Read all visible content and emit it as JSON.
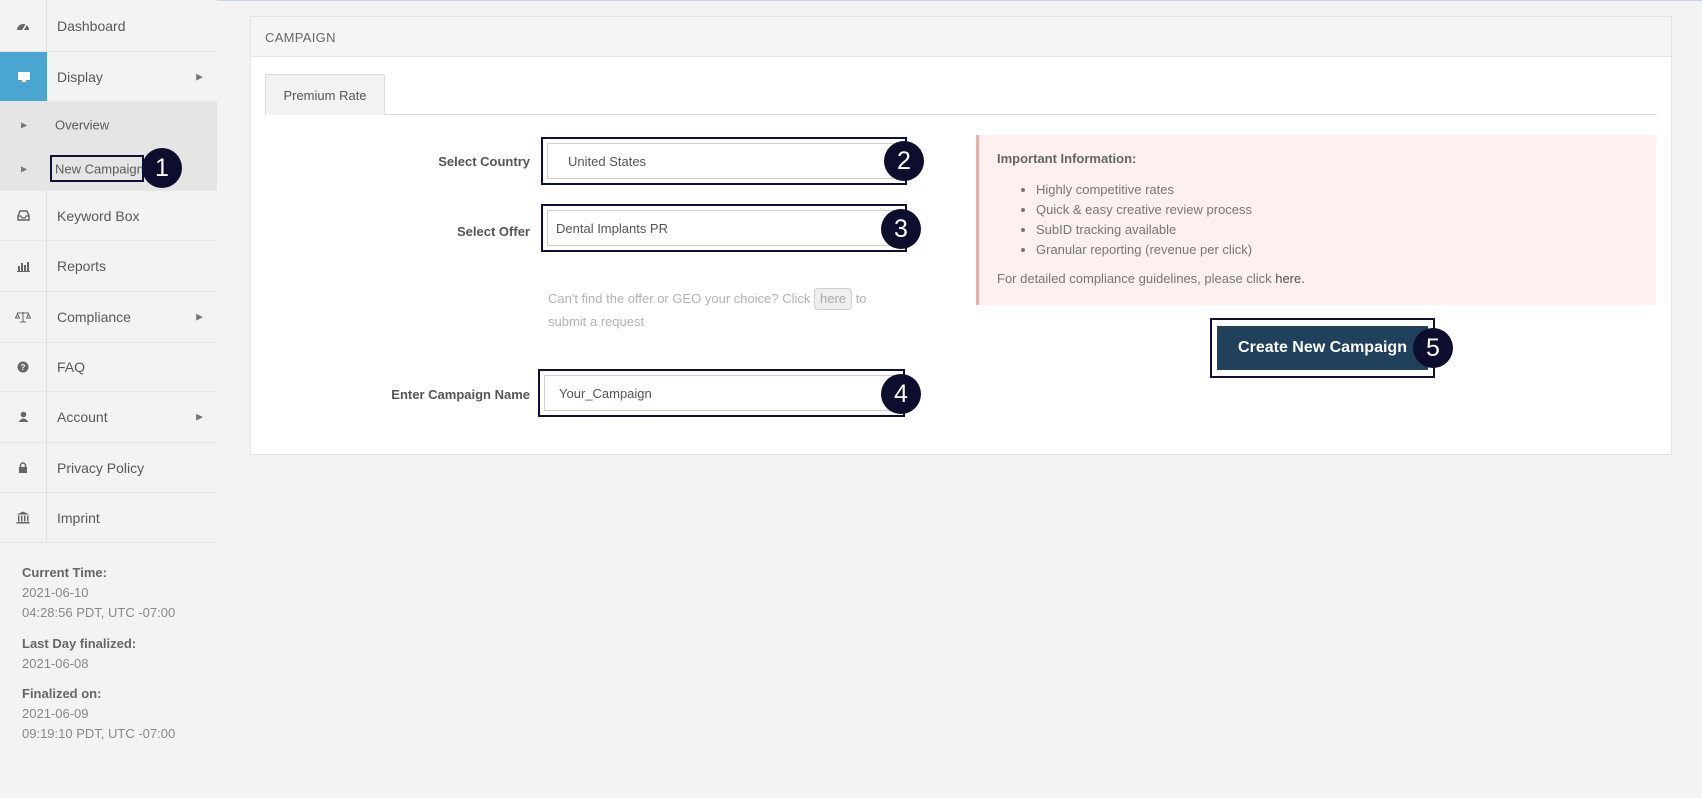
{
  "sidebar": {
    "items": [
      {
        "label": "Dashboard",
        "icon": "dashboard-icon"
      },
      {
        "label": "Display",
        "icon": "monitor-icon"
      },
      {
        "label": "Keyword Box",
        "icon": "inbox-icon"
      },
      {
        "label": "Reports",
        "icon": "bar-chart-icon"
      },
      {
        "label": "Compliance",
        "icon": "scale-icon"
      },
      {
        "label": "FAQ",
        "icon": "question-icon"
      },
      {
        "label": "Account",
        "icon": "user-icon"
      },
      {
        "label": "Privacy Policy",
        "icon": "lock-icon"
      },
      {
        "label": "Imprint",
        "icon": "bank-icon"
      }
    ],
    "submenu": [
      {
        "label": "Overview"
      },
      {
        "label": "New Campaign"
      }
    ],
    "current_time_label": "Current Time:",
    "current_time_date": "2021-06-10",
    "current_time_time": "04:28:56 PDT, UTC -07:00",
    "last_day_label": "Last Day finalized:",
    "last_day_value": "2021-06-08",
    "finalized_label": "Finalized on:",
    "finalized_date": "2021-06-09",
    "finalized_time": "09:19:10 PDT, UTC -07:00"
  },
  "panel": {
    "title": "CAMPAIGN",
    "tab_label": "Premium Rate"
  },
  "form": {
    "country_label": "Select Country",
    "country_value": "United States",
    "offer_label": "Select Offer",
    "offer_value": "Dental Implants PR",
    "help_text_1": "Can't find the offer or GEO your choice? Click",
    "help_link": "here",
    "help_text_2": "to",
    "help_text_3": "submit a request",
    "campaign_label": "Enter Campaign Name",
    "campaign_value": "Your_Campaign"
  },
  "info": {
    "header": "Important Information:",
    "bullets": [
      "Highly competitive rates",
      "Quick & easy creative review process",
      "SubID tracking available",
      "Granular reporting (revenue per click)"
    ],
    "footer_text": "For detailed compliance guidelines, please click",
    "footer_link": "here."
  },
  "create_button_label": "Create New Campaign",
  "badges": [
    "1",
    "2",
    "3",
    "4",
    "5"
  ],
  "colors": {
    "accent": "#4aa5d0",
    "button": "#21405c",
    "badge": "#0d0e2e",
    "info_bg": "#fdf0ee"
  }
}
